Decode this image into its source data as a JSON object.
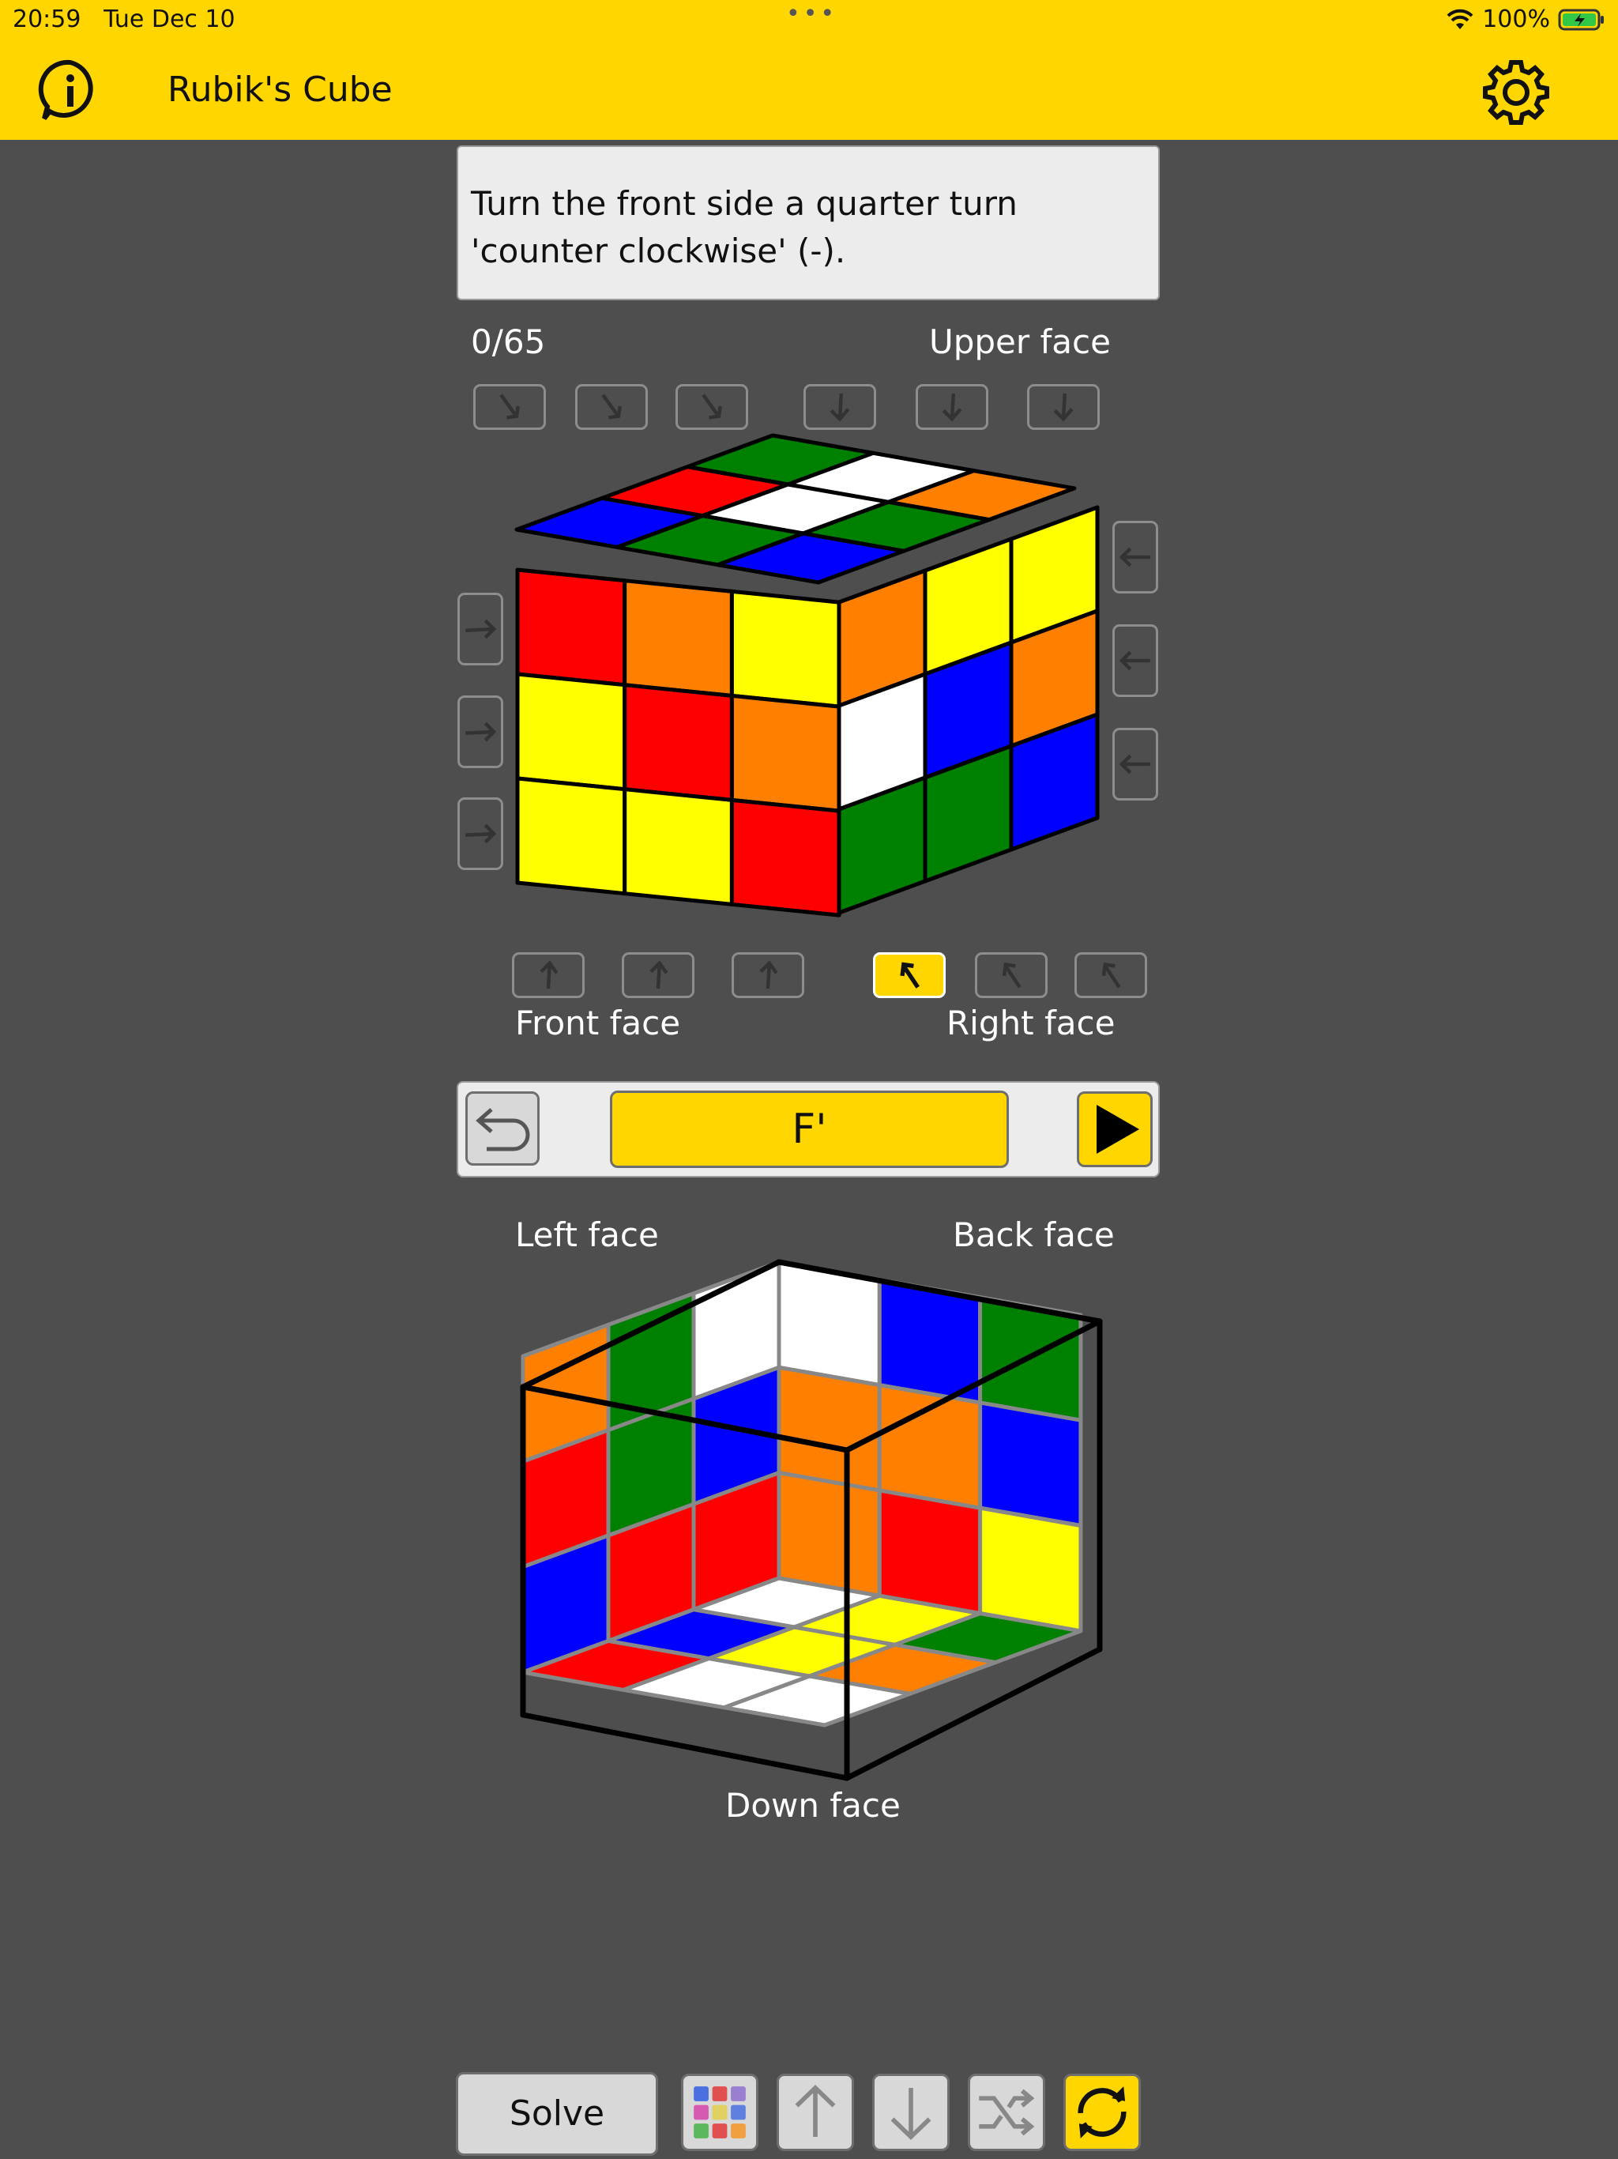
{
  "status": {
    "time": "20:59",
    "date": "Tue Dec 10",
    "battery": "100%",
    "dots": "•••"
  },
  "header": {
    "title": "Rubik's Cube",
    "info_icon": "info-icon",
    "settings_icon": "gear-icon"
  },
  "instruction": "Turn the front side a quarter turn 'counter clockwise' (-).",
  "progress": "0/65",
  "labels": {
    "upper": "Upper face",
    "front": "Front face",
    "right": "Right face",
    "left": "Left face",
    "back": "Back face",
    "down": "Down face"
  },
  "move": {
    "current": "F'",
    "undo_icon": "undo-icon",
    "play_icon": "play-icon"
  },
  "toolbar": {
    "solve": "Solve",
    "icons": [
      "color-palette-icon",
      "arrow-up-icon",
      "arrow-down-icon",
      "shuffle-icon",
      "refresh-icon"
    ]
  },
  "colors": {
    "accent": "#ffd600",
    "background": "#4e4e4e",
    "R": "#ff0000",
    "O": "#ff8000",
    "Y": "#ffff00",
    "G": "#008000",
    "B": "#0000ff",
    "W": "#ffffff"
  },
  "cube_front": {
    "upper": [
      [
        "G",
        "W",
        "O"
      ],
      [
        "R",
        "W",
        "G"
      ],
      [
        "B",
        "G",
        "B"
      ]
    ],
    "front": [
      [
        "R",
        "O",
        "Y"
      ],
      [
        "Y",
        "R",
        "O"
      ],
      [
        "Y",
        "Y",
        "R"
      ]
    ],
    "right": [
      [
        "O",
        "Y",
        "Y"
      ],
      [
        "W",
        "B",
        "O"
      ],
      [
        "G",
        "G",
        "B"
      ]
    ]
  },
  "cube_back": {
    "left": [
      [
        "W",
        "G",
        "O"
      ],
      [
        "B",
        "G",
        "R"
      ],
      [
        "R",
        "R",
        "B"
      ]
    ],
    "back": [
      [
        "W",
        "B",
        "G"
      ],
      [
        "O",
        "O",
        "B"
      ],
      [
        "O",
        "R",
        "Y"
      ]
    ],
    "down": [
      [
        "W",
        "B",
        "R"
      ],
      [
        "Y",
        "Y",
        "W"
      ],
      [
        "G",
        "O",
        "W"
      ]
    ]
  }
}
